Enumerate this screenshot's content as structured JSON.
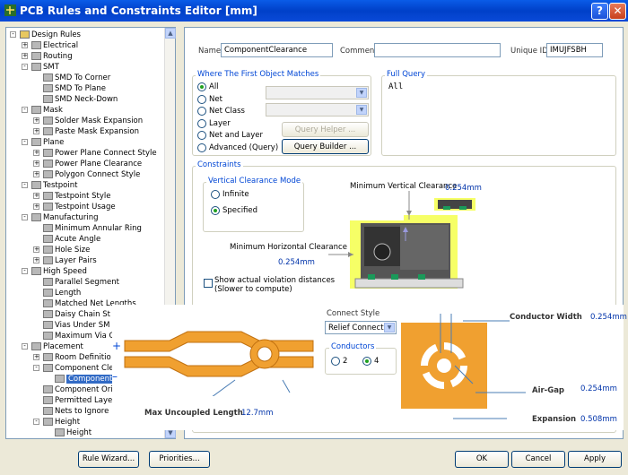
{
  "window": {
    "title": "PCB Rules and Constraints Editor [mm]",
    "help": "?",
    "close": "✕"
  },
  "tree": [
    {
      "label": "Design Rules",
      "depth": 0,
      "exp": "-",
      "icon": "folder"
    },
    {
      "label": "Electrical",
      "depth": 1,
      "exp": "+",
      "icon": "rule"
    },
    {
      "label": "Routing",
      "depth": 1,
      "exp": "+",
      "icon": "rule"
    },
    {
      "label": "SMT",
      "depth": 1,
      "exp": "-",
      "icon": "rule"
    },
    {
      "label": "SMD To Corner",
      "depth": 2,
      "exp": "",
      "icon": "rule"
    },
    {
      "label": "SMD To Plane",
      "depth": 2,
      "exp": "",
      "icon": "rule"
    },
    {
      "label": "SMD Neck-Down",
      "depth": 2,
      "exp": "",
      "icon": "rule"
    },
    {
      "label": "Mask",
      "depth": 1,
      "exp": "-",
      "icon": "rule"
    },
    {
      "label": "Solder Mask Expansion",
      "depth": 2,
      "exp": "+",
      "icon": "rule"
    },
    {
      "label": "Paste Mask Expansion",
      "depth": 2,
      "exp": "+",
      "icon": "rule"
    },
    {
      "label": "Plane",
      "depth": 1,
      "exp": "-",
      "icon": "rule"
    },
    {
      "label": "Power Plane Connect Style",
      "depth": 2,
      "exp": "+",
      "icon": "rule"
    },
    {
      "label": "Power Plane Clearance",
      "depth": 2,
      "exp": "+",
      "icon": "rule"
    },
    {
      "label": "Polygon Connect Style",
      "depth": 2,
      "exp": "+",
      "icon": "rule"
    },
    {
      "label": "Testpoint",
      "depth": 1,
      "exp": "-",
      "icon": "rule"
    },
    {
      "label": "Testpoint Style",
      "depth": 2,
      "exp": "+",
      "icon": "rule"
    },
    {
      "label": "Testpoint Usage",
      "depth": 2,
      "exp": "+",
      "icon": "rule"
    },
    {
      "label": "Manufacturing",
      "depth": 1,
      "exp": "-",
      "icon": "rule"
    },
    {
      "label": "Minimum Annular Ring",
      "depth": 2,
      "exp": "",
      "icon": "rule"
    },
    {
      "label": "Acute Angle",
      "depth": 2,
      "exp": "",
      "icon": "rule"
    },
    {
      "label": "Hole Size",
      "depth": 2,
      "exp": "+",
      "icon": "rule"
    },
    {
      "label": "Layer Pairs",
      "depth": 2,
      "exp": "+",
      "icon": "rule"
    },
    {
      "label": "High Speed",
      "depth": 1,
      "exp": "-",
      "icon": "rule"
    },
    {
      "label": "Parallel Segment",
      "depth": 2,
      "exp": "",
      "icon": "rule"
    },
    {
      "label": "Length",
      "depth": 2,
      "exp": "",
      "icon": "rule"
    },
    {
      "label": "Matched Net Lengths",
      "depth": 2,
      "exp": "",
      "icon": "rule"
    },
    {
      "label": "Daisy Chain St",
      "depth": 2,
      "exp": "",
      "icon": "rule"
    },
    {
      "label": "Vias Under SM",
      "depth": 2,
      "exp": "",
      "icon": "rule"
    },
    {
      "label": "Maximum Via C",
      "depth": 2,
      "exp": "",
      "icon": "rule"
    },
    {
      "label": "Placement",
      "depth": 1,
      "exp": "-",
      "icon": "rule"
    },
    {
      "label": "Room Definitio",
      "depth": 2,
      "exp": "+",
      "icon": "rule"
    },
    {
      "label": "Component Cle",
      "depth": 2,
      "exp": "-",
      "icon": "rule"
    },
    {
      "label": "Component",
      "depth": 3,
      "exp": "",
      "icon": "rule",
      "selected": true
    },
    {
      "label": "Component Ori",
      "depth": 2,
      "exp": "",
      "icon": "rule"
    },
    {
      "label": "Permitted Laye",
      "depth": 2,
      "exp": "",
      "icon": "rule"
    },
    {
      "label": "Nets to Ignore",
      "depth": 2,
      "exp": "",
      "icon": "rule"
    },
    {
      "label": "Height",
      "depth": 2,
      "exp": "-",
      "icon": "rule"
    },
    {
      "label": "Height",
      "depth": 3,
      "exp": "",
      "icon": "rule"
    }
  ],
  "header": {
    "name_label": "Name",
    "name_value": "ComponentClearance",
    "comment_label": "Comment",
    "comment_value": "",
    "uid_label": "Unique ID",
    "uid_value": "IMUJFSBH"
  },
  "where": {
    "title": "Where The First Object Matches",
    "options": [
      "All",
      "Net",
      "Net Class",
      "Layer",
      "Net and Layer",
      "Advanced (Query)"
    ],
    "selected": 0,
    "query_helper": "Query Helper ...",
    "query_builder": "Query Builder ..."
  },
  "full_query": {
    "title": "Full Query",
    "text": "All"
  },
  "constraints": {
    "title": "Constraints",
    "mode_title": "Vertical Clearance Mode",
    "mode_options": [
      "Infinite",
      "Specified"
    ],
    "mode_selected": 1,
    "min_vertical_label": "Minimum Vertical Clearance",
    "min_vertical_value": "0.254mm",
    "min_horizontal_label": "Minimum Horizontal Clearance",
    "min_horizontal_value": "0.254mm",
    "show_actual_line1": "Show actual violation distances",
    "show_actual_line2": "(Slower to compute)"
  },
  "overlay": {
    "connect_style_label": "Connect Style",
    "connect_style_value": "Relief Connect",
    "conductors_label": "Conductors",
    "conductor_options": [
      "2",
      "4"
    ],
    "conductor_selected": 1,
    "conductor_width_label": "Conductor Width",
    "conductor_width_value": "0.254mm",
    "air_gap_label": "Air-Gap",
    "air_gap_value": "0.254mm",
    "expansion_label": "Expansion",
    "expansion_value": "0.508mm",
    "max_uncoupled_label": "Max Uncoupled Length",
    "max_uncoupled_value": "12.7mm"
  },
  "footer": {
    "rule_wizard": "Rule Wizard...",
    "priorities": "Priorities...",
    "ok": "OK",
    "cancel": "Cancel",
    "apply": "Apply"
  },
  "colors": {
    "accent": "#0046d5",
    "title_bar": "#0a5ce8",
    "copper": "#f0a030",
    "board": "#3a3a3a",
    "selection": "#316ac5"
  }
}
